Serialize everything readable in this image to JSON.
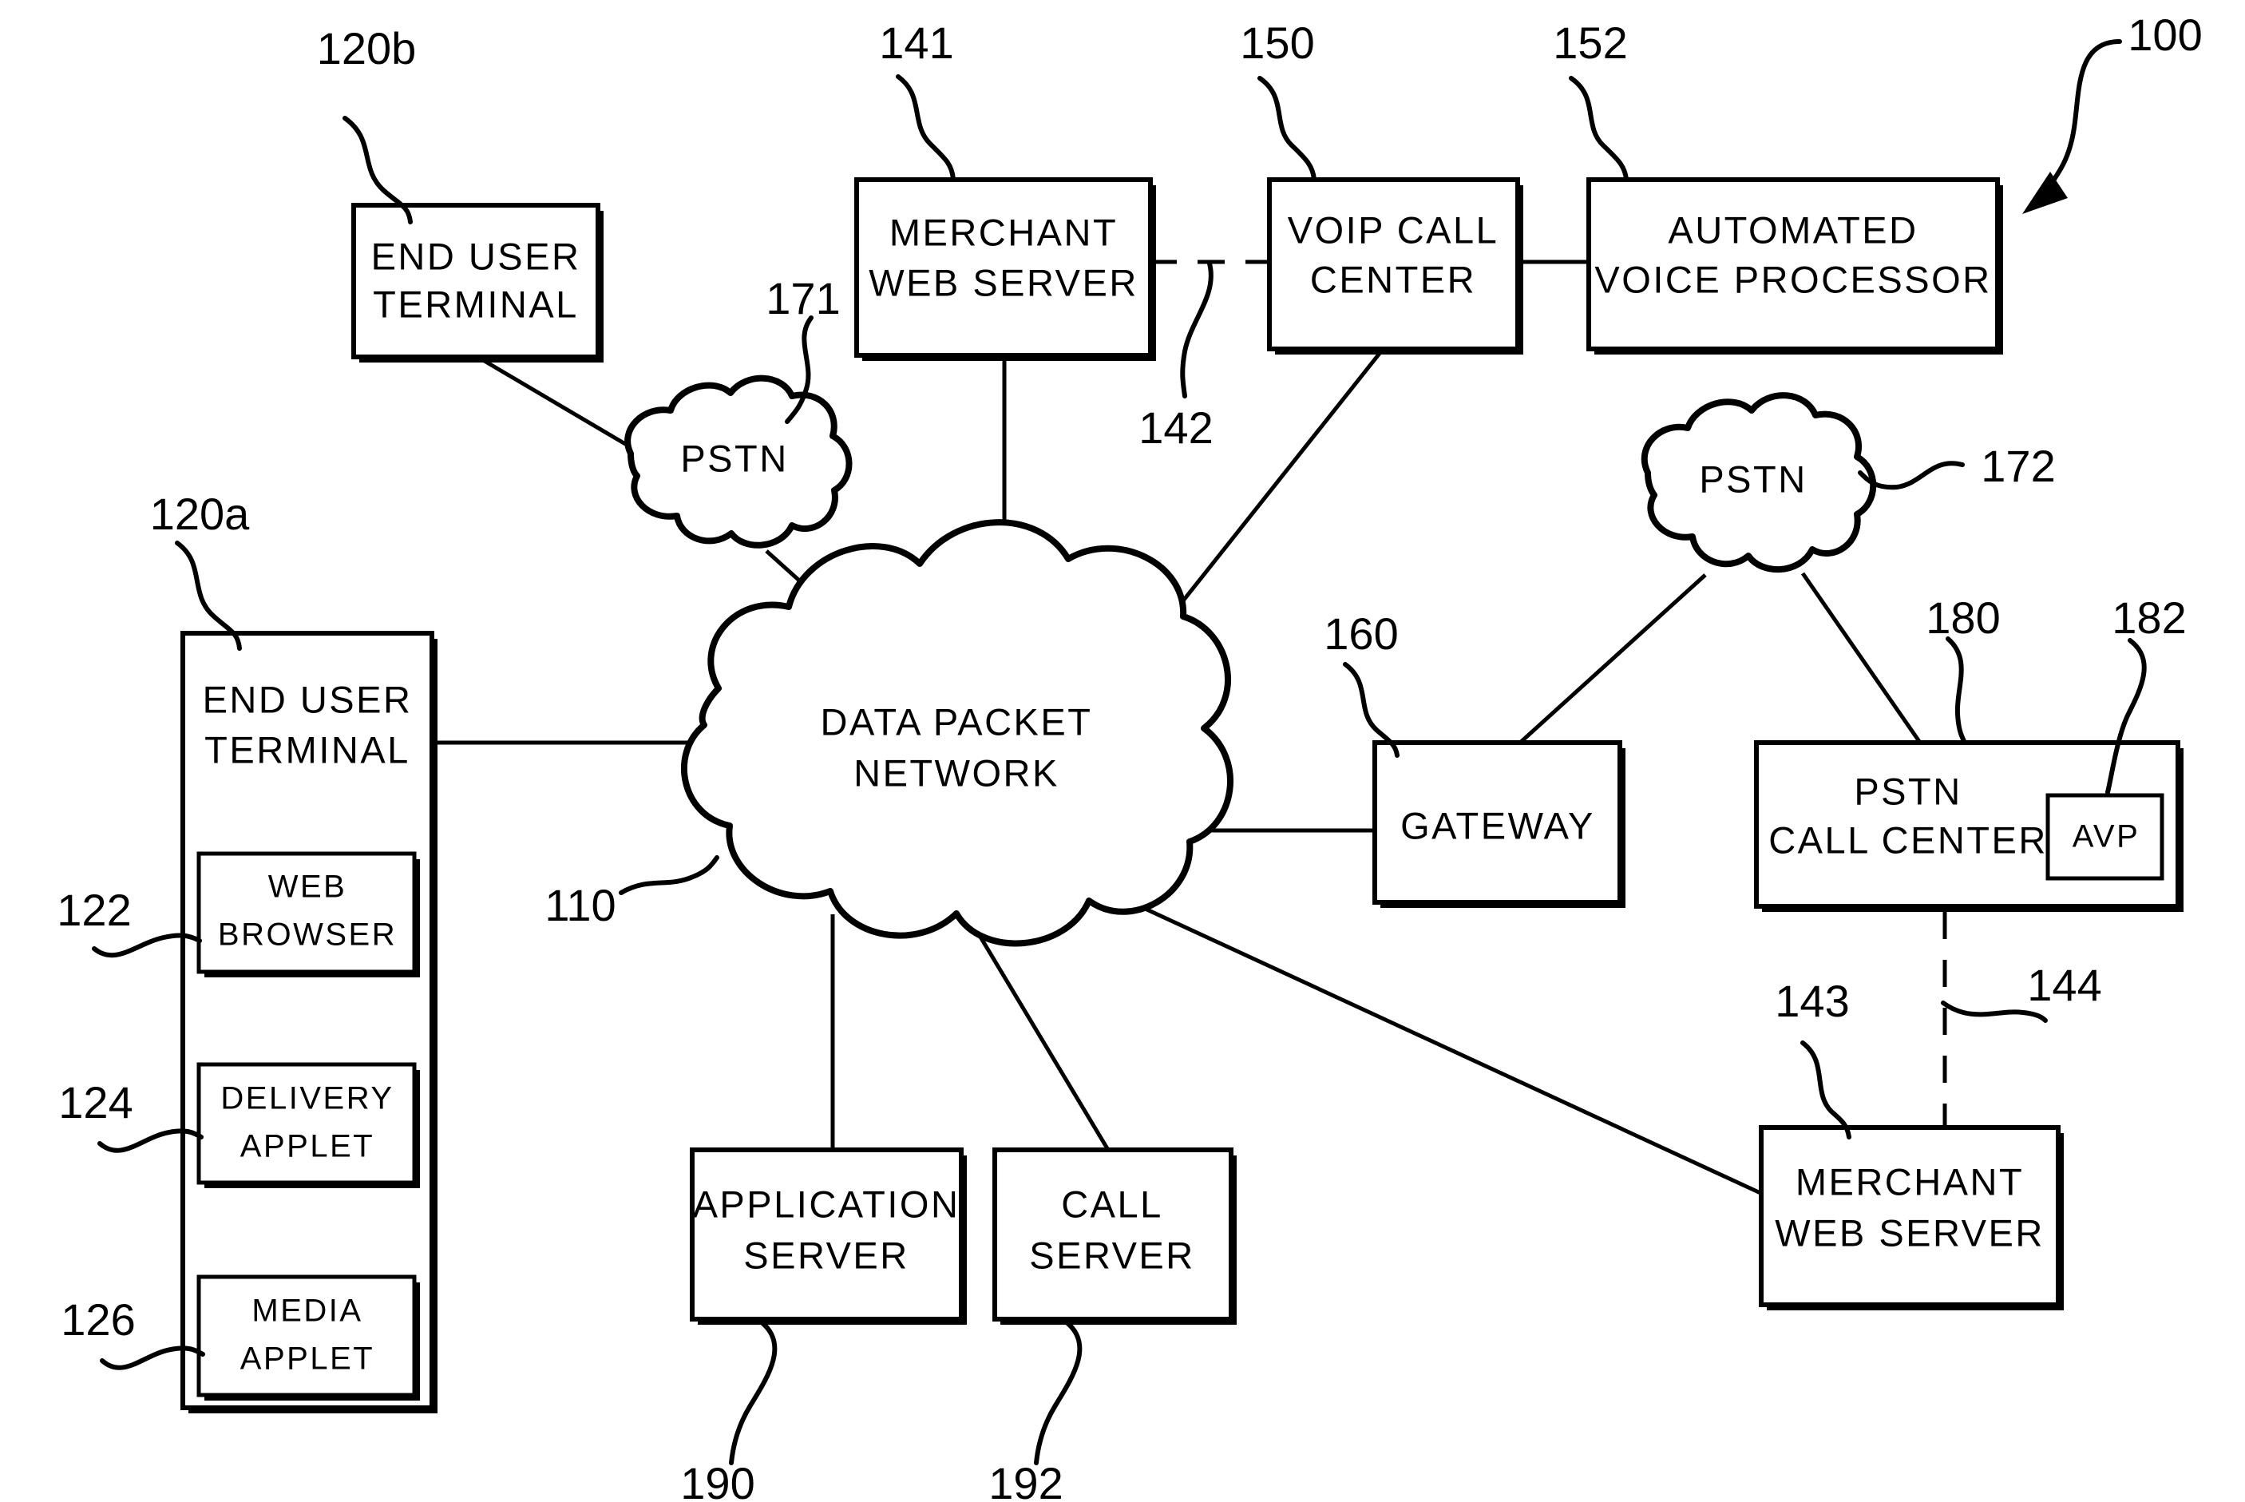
{
  "figure": {
    "title_ref": "100",
    "nodes": {
      "end_user_terminal_b": {
        "ref": "120b",
        "line1": "END  USER",
        "line2": "TERMINAL"
      },
      "end_user_terminal_a": {
        "ref": "120a",
        "line1": "END  USER",
        "line2": "TERMINAL"
      },
      "web_browser": {
        "ref": "122",
        "line1": "WEB",
        "line2": "BROWSER"
      },
      "delivery_applet": {
        "ref": "124",
        "line1": "DELIVERY",
        "line2": "APPLET"
      },
      "media_applet": {
        "ref": "126",
        "line1": "MEDIA",
        "line2": "APPLET"
      },
      "merchant_web_server_top": {
        "ref": "141",
        "line1": "MERCHANT",
        "line2": "WEB SERVER"
      },
      "voip_call_center": {
        "ref": "150",
        "line1": "VOIP CALL",
        "line2": "CENTER"
      },
      "automated_voice_processor": {
        "ref": "152",
        "line1": "AUTOMATED",
        "line2": "VOICE PROCESSOR"
      },
      "pstn_left": {
        "ref": "171",
        "label": "PSTN"
      },
      "pstn_right": {
        "ref": "172",
        "label": "PSTN"
      },
      "data_packet_network": {
        "ref": "110",
        "line1": "DATA  PACKET",
        "line2": "NETWORK"
      },
      "gateway": {
        "ref": "160",
        "label": "GATEWAY"
      },
      "pstn_call_center": {
        "ref": "180",
        "line1": "PSTN",
        "line2": "CALL  CENTER"
      },
      "avp": {
        "ref": "182",
        "label": "AVP"
      },
      "merchant_web_server_bottom": {
        "ref": "143",
        "line1": "MERCHANT",
        "line2": "WEB SERVER"
      },
      "application_server": {
        "ref": "190",
        "line1": "APPLICATION",
        "line2": "SERVER"
      },
      "call_server": {
        "ref": "192",
        "line1": "CALL",
        "line2": "SERVER"
      }
    },
    "connection_refs": {
      "merchant_to_voip_dashed": "142",
      "pstn_call_center_to_merchant_dashed": "144"
    },
    "colors": {
      "ink": "#000000",
      "paper": "#ffffff"
    }
  }
}
